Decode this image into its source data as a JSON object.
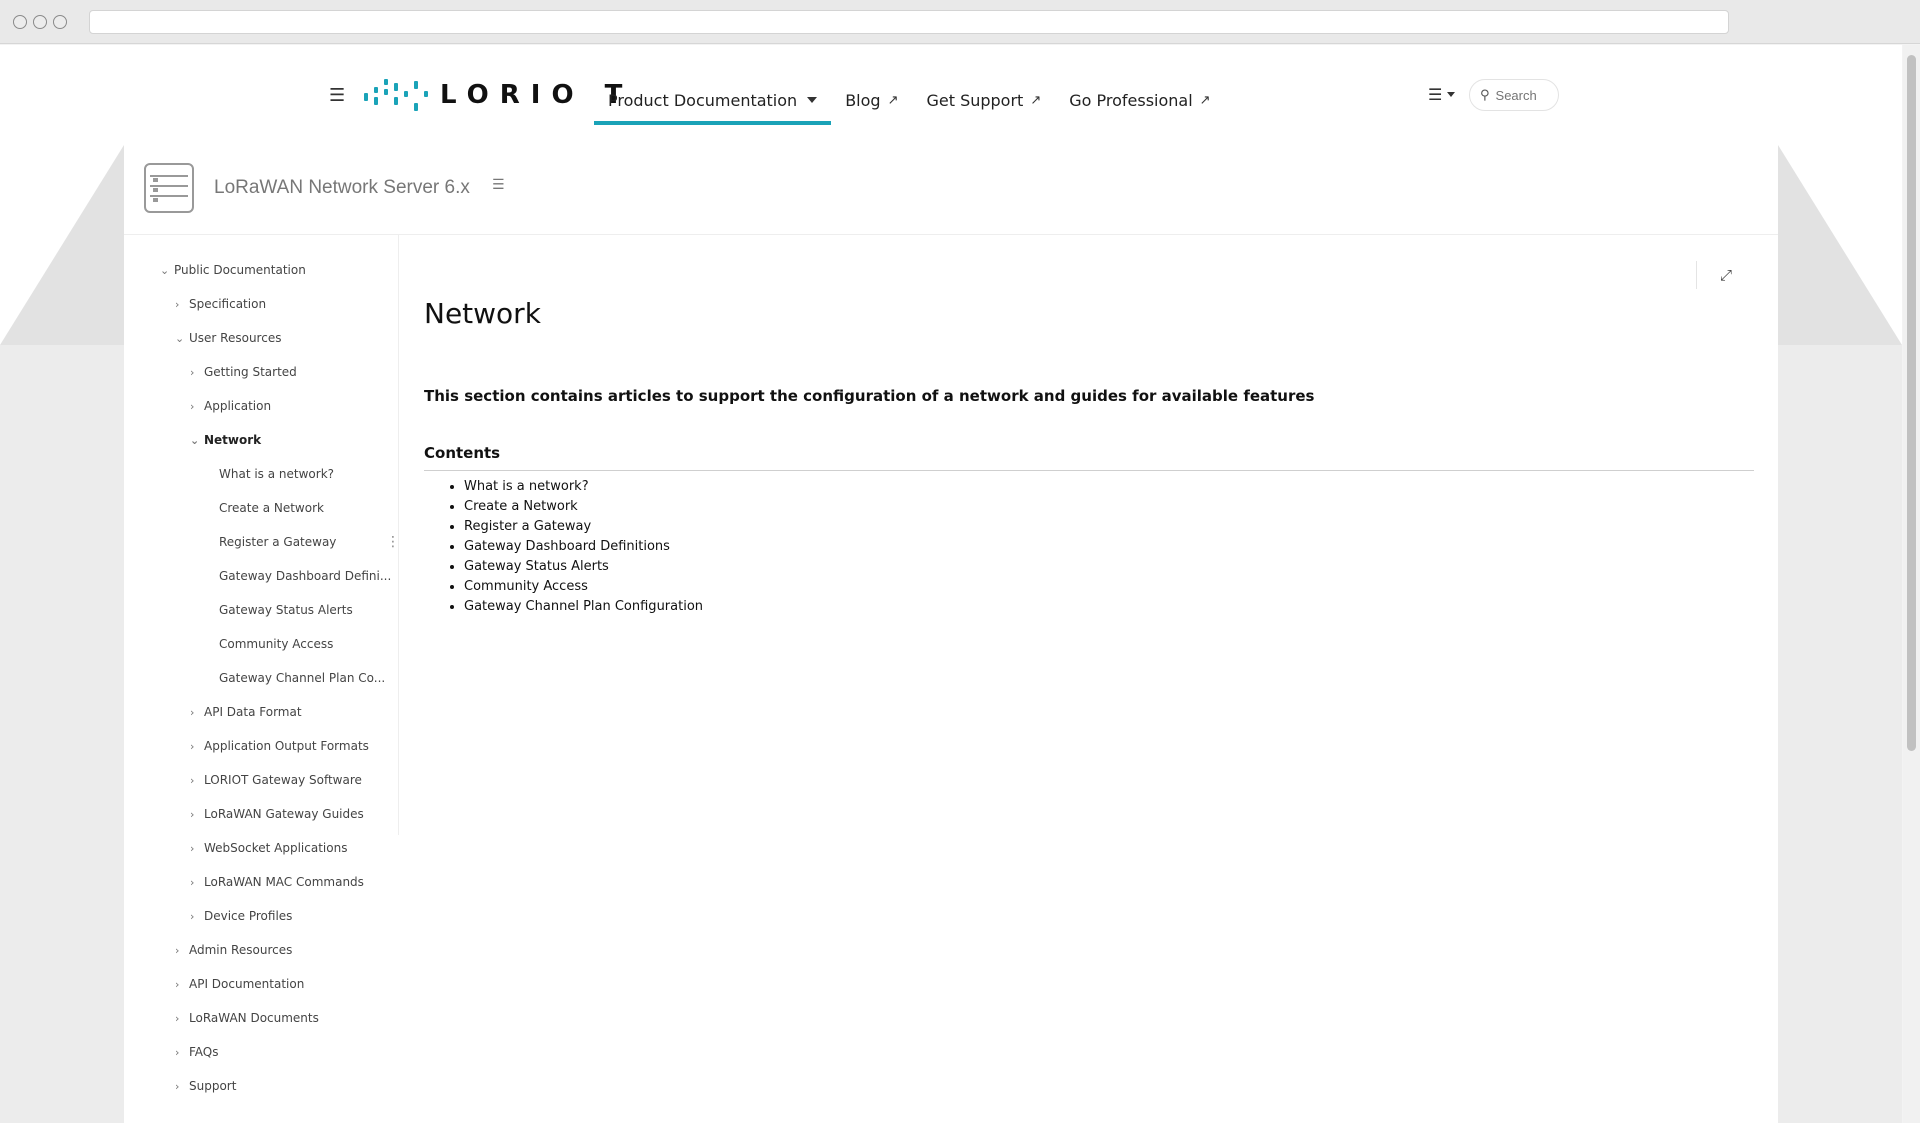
{
  "header": {
    "brand": "LORIO T",
    "nav": [
      {
        "label": "Product Documentation",
        "active": true,
        "dropdown": true
      },
      {
        "label": "Blog",
        "external": true
      },
      {
        "label": "Get Support",
        "external": true
      },
      {
        "label": "Go Professional",
        "external": true
      }
    ],
    "search_placeholder": "Search"
  },
  "space": {
    "title": "LoRaWAN Network Server 6.x"
  },
  "sidebar": {
    "items": [
      {
        "label": "Public Documentation",
        "chevron": "down",
        "level": 0
      },
      {
        "label": "Specification",
        "chevron": "right",
        "level": 1
      },
      {
        "label": "User Resources",
        "chevron": "down",
        "level": 1
      },
      {
        "label": "Getting Started",
        "chevron": "right",
        "level": 2
      },
      {
        "label": "Application",
        "chevron": "right",
        "level": 2
      },
      {
        "label": "Network",
        "chevron": "down",
        "level": 2,
        "current": true
      },
      {
        "label": "What is a network?",
        "chevron": "",
        "level": 3
      },
      {
        "label": "Create a Network",
        "chevron": "",
        "level": 3
      },
      {
        "label": "Register a Gateway",
        "chevron": "",
        "level": 3
      },
      {
        "label": "Gateway Dashboard Defini...",
        "chevron": "",
        "level": 3
      },
      {
        "label": "Gateway Status Alerts",
        "chevron": "",
        "level": 3
      },
      {
        "label": "Community Access",
        "chevron": "",
        "level": 3
      },
      {
        "label": "Gateway Channel Plan Co...",
        "chevron": "",
        "level": 3
      },
      {
        "label": "API Data Format",
        "chevron": "right",
        "level": 2
      },
      {
        "label": "Application Output Formats",
        "chevron": "right",
        "level": 2
      },
      {
        "label": "LORIOT Gateway Software",
        "chevron": "right",
        "level": 2
      },
      {
        "label": "LoRaWAN Gateway Guides",
        "chevron": "right",
        "level": 2
      },
      {
        "label": "WebSocket Applications",
        "chevron": "right",
        "level": 2
      },
      {
        "label": "LoRaWAN MAC Commands",
        "chevron": "right",
        "level": 2
      },
      {
        "label": "Device Profiles",
        "chevron": "right",
        "level": 2
      },
      {
        "label": "Admin Resources",
        "chevron": "right",
        "level": 1
      },
      {
        "label": "API Documentation",
        "chevron": "right",
        "level": 1
      },
      {
        "label": "LoRaWAN Documents",
        "chevron": "right",
        "level": 1
      },
      {
        "label": "FAQs",
        "chevron": "right",
        "level": 1
      },
      {
        "label": "Support",
        "chevron": "right",
        "level": 1
      }
    ]
  },
  "content": {
    "title": "Network",
    "intro": "This section contains articles to support the configuration of a network and guides for available features",
    "contents_heading": "Contents",
    "toc": [
      "What is a network?",
      "Create a Network",
      "Register a Gateway",
      "Gateway Dashboard Definitions",
      "Gateway Status Alerts",
      "Community Access",
      "Gateway Channel Plan Configuration"
    ]
  },
  "colors": {
    "accent": "#1aa3b8"
  },
  "icons": {
    "hamburger": "hamburger-icon",
    "external": "external-link-icon",
    "list": "list-icon",
    "search": "search-icon",
    "expand": "expand-icon",
    "space": "server-icon",
    "kebab": "more-vertical-icon"
  }
}
